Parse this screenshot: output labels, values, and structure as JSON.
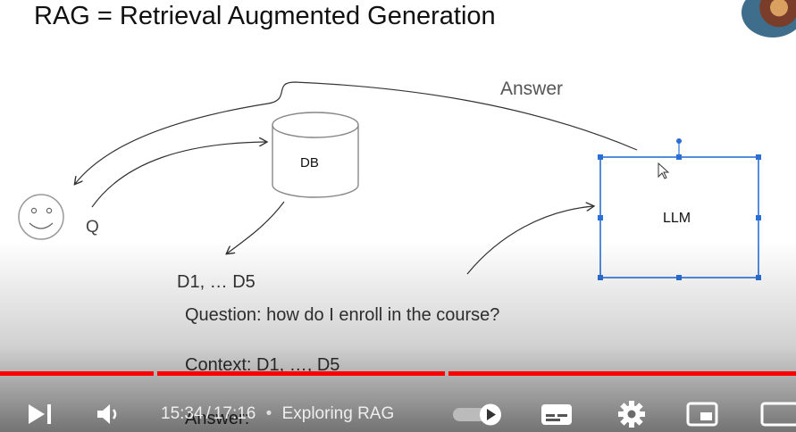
{
  "slide": {
    "title": "RAG = Retrieval Augmented Generation",
    "db_label": "DB",
    "llm_label": "LLM",
    "answer_label": "Answer",
    "q_label": "Q",
    "docs_label": "D1, … D5",
    "prompt_lines": {
      "question": "Question: how do I enroll in the course?",
      "context": "Context: D1, …, D5",
      "answer": "Answer:"
    }
  },
  "player": {
    "current_time": "15:34",
    "duration": "17:16",
    "time_separator": "/",
    "chapter_separator": "•",
    "chapter_title": "Exploring RAG",
    "progress_fraction": 0.902,
    "progress_color": "#ff0000",
    "icons": [
      "next-icon",
      "volume-icon",
      "autoplay-toggle",
      "subtitles-icon",
      "settings-gear-icon",
      "miniplayer-icon",
      "theater-mode-icon"
    ]
  }
}
